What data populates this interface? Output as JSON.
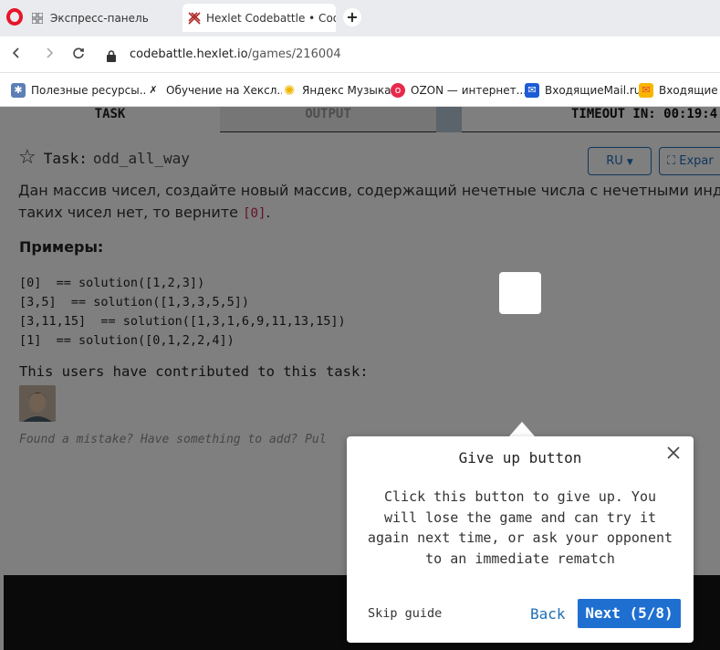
{
  "browser": {
    "tabs": [
      {
        "label": "Экспресс-панель",
        "icon": "grid-icon"
      },
      {
        "label": "Hexlet Codebattle • Cool g",
        "icon": "hexlet-icon"
      }
    ],
    "new_tab": "+",
    "url_host": "codebattle.hexlet.io",
    "url_path": "/games/216004",
    "bookmarks": [
      {
        "label": "Полезные ресурсы...",
        "icon": "bookmark-blue-icon",
        "color": "#5c7fb6"
      },
      {
        "label": "Обучение на Хексл...",
        "icon": "hexlet-icon",
        "color": "#222222"
      },
      {
        "label": "Яндекс Музыка",
        "icon": "yandex-music-icon",
        "color": "#f7c21a"
      },
      {
        "label": "OZON — интернет...",
        "icon": "ozon-icon",
        "color": "#1460f2"
      },
      {
        "label": "ВходящиеMail.ru",
        "icon": "mail-icon",
        "color": "#1d5bd6"
      },
      {
        "label": "Входящие Я",
        "icon": "mail-yandex-icon",
        "color": "#e44"
      }
    ]
  },
  "page": {
    "tab_task": "TASK",
    "tab_output": "OUTPUT",
    "timeout": "TIMEOUT IN: 00:19:4",
    "task_label": "Task:",
    "task_name": "odd_all_way",
    "lang_button": "RU",
    "expand_button": "Expar",
    "description_line1": "Дан массив чисел, создайте новый массив, содержащий нечетные числа с нечетными инде",
    "description_line2": "таких чисел нет, то верните",
    "description_code": "[0]",
    "description_end": ".",
    "examples_title": "Примеры:",
    "examples": "[0]  == solution([1,2,3])\n[3,5]  == solution([1,3,3,5,5])\n[3,11,15]  == solution([1,3,1,6,9,11,13,15])\n[1]  == solution([0,1,2,2,4])",
    "contributors_title": "This users have contributed to this task:",
    "mistake_text": "Found a mistake? Have something to add? Pul"
  },
  "guide": {
    "title": "Give up button",
    "body": "Click this button to give up. You will lose the game and can try it again next time, or ask your opponent to an immediate rematch",
    "skip": "Skip guide",
    "back": "Back",
    "next": "Next (5/8)"
  }
}
